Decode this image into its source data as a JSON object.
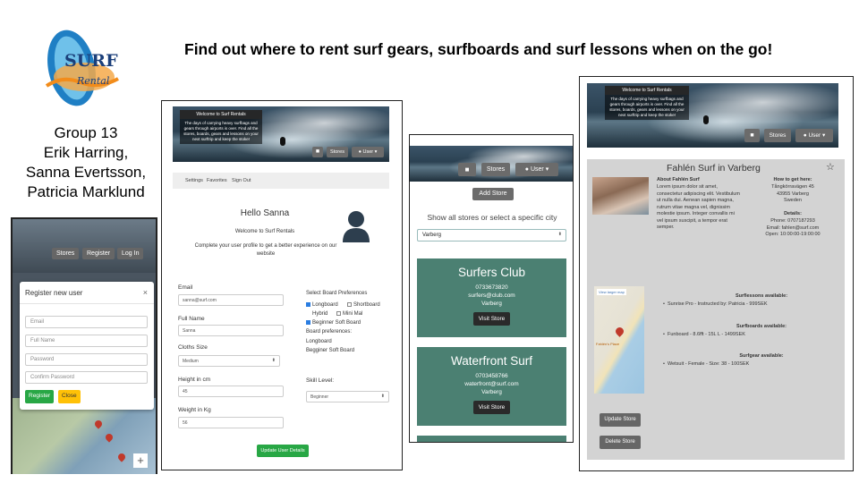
{
  "headline": "Find out where to rent surf gears, surfboards and surf lessons when on the go!",
  "logo": {
    "text1": "SURF",
    "text2": "Rental"
  },
  "group": {
    "title": "Group 13",
    "members": [
      "Erik Harring,",
      "Sanna Evertsson,",
      "Patricia Marklund"
    ]
  },
  "colors": {
    "store_card": "#4b8072",
    "update_button": "#28a745",
    "close_button": "#ffc107",
    "nav_button": "#6b6b6b"
  },
  "hero": {
    "title": "Welcome to Surf Rentals",
    "text": "The days of carrying heavy surfbags and gears through airports is over. Find all the stores, boards, gears and lessons on your next surftrip and keep the stoke!"
  },
  "nav": {
    "stores": "Stores",
    "user": "User",
    "register": "Register",
    "login": "Log In"
  },
  "register": {
    "title": "Register new user",
    "close_x": "×",
    "email_placeholder": "Email",
    "fullname_placeholder": "Full Name",
    "password_placeholder": "Password",
    "confirm_placeholder": "Confirm Password",
    "register_label": "Register",
    "close_label": "Close"
  },
  "profile": {
    "tabs": [
      "Settings",
      "Favorites",
      "Sign Out"
    ],
    "greeting": "Hello Sanna",
    "welcome": "Welcome to Surf Rentals",
    "subtitle": "Complete your user profile to get a better experience on our website",
    "email_label": "Email",
    "email_value": "sanna@surf.com",
    "fullname_label": "Full Name",
    "fullname_value": "Sanna",
    "clothes_label": "Cloths Size",
    "clothes_value": "Medium",
    "height_label": "Height in cm",
    "height_value": "45",
    "weight_label": "Weight in Kg",
    "weight_value": "56",
    "board_pref_label": "Select Board Preferences",
    "boards": [
      {
        "label": "Longboard",
        "checked": true
      },
      {
        "label": "Shortboard",
        "checked": false
      },
      {
        "label": "Hybrid",
        "checked": false
      },
      {
        "label": "Mini Mal",
        "checked": false
      },
      {
        "label": "Beginner Soft Board",
        "checked": true
      }
    ],
    "board_prefs_heading": "Board preferences:",
    "board_prefs": [
      "Longboard",
      "Begginer Soft Board"
    ],
    "skill_label": "Skill Level:",
    "skill_value": "Beginner",
    "update_label": "Update User Details"
  },
  "stores": {
    "add_label": "Add Store",
    "filter_label": "Show all stores or select a specific city",
    "city_value": "Varberg",
    "visit_label": "Visit Store",
    "cards": [
      {
        "name": "Surfers Club",
        "phone": "0733673820",
        "email": "surfers@club.com",
        "city": "Varberg"
      },
      {
        "name": "Waterfront Surf",
        "phone": "0703458766",
        "email": "waterfront@surf.com",
        "city": "Varberg"
      }
    ]
  },
  "detail": {
    "title": "Fahlén Surf in Varberg",
    "star": "☆",
    "about_heading": "About Fahlén Surf",
    "about_text": "Lorem ipsum dolor sit amet, consectetur adipiscing elit. Vestibulum ut nulla dui. Aenean sapien magna, rutrum vitae magna vel, dignissim molestie ipsum. Integer convallis mi vel ipsum suscipit, a tempor erat semper.",
    "howto_heading": "How to get here:",
    "address": [
      "Tångkörravägen 45",
      "43955 Varberg",
      "Sweden"
    ],
    "details_heading": "Details:",
    "phone": "Phone: 0707187293",
    "email": "Email: fahlen@surf.com",
    "open": "Open: 10:00:00-19:00:00",
    "map_link": "View larger map",
    "map_place": "Fahlén's Place",
    "lessons_heading": "Surflessons available:",
    "lessons_item": "Sunrise Pro - Instructed by: Patricia - 999SEK",
    "boards_heading": "Surfboards available:",
    "boards_item": "Funboard - 8.6fft - 15L L - 1499SEK",
    "gear_heading": "Surfgear available:",
    "gear_item": "Wetsuit - Female - Size: 38 - 100SEK",
    "update_label": "Update Store",
    "delete_label": "Delete Store"
  }
}
